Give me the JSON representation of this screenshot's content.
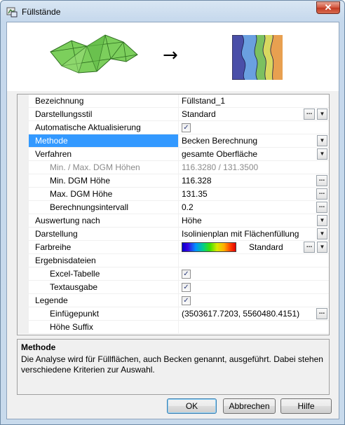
{
  "window": {
    "title": "Füllstände",
    "close_glyph": "✕"
  },
  "banner": {
    "arrow": "→"
  },
  "properties": [
    {
      "label": "Bezeichnung",
      "value": "Füllstand_1"
    },
    {
      "label": "Darstellungsstil",
      "value": "Standard"
    },
    {
      "label": "Automatische Aktualisierung",
      "checked": true
    },
    {
      "label": "Methode",
      "value": "Becken Berechnung",
      "selected": true
    },
    {
      "label": "Verfahren",
      "value": "gesamte Oberfläche"
    },
    {
      "label": "Min. / Max. DGM Höhen",
      "value": "116.3280 / 131.3500",
      "disabled": true
    },
    {
      "label": "Min. DGM Höhe",
      "value": "116.328"
    },
    {
      "label": "Max. DGM Höhe",
      "value": "131.35"
    },
    {
      "label": "Berechnungsintervall",
      "value": "0.2"
    },
    {
      "label": "Auswertung nach",
      "value": "Höhe"
    },
    {
      "label": "Darstellung",
      "value": "Isolinienplan mit Flächenfüllung"
    },
    {
      "label": "Farbreihe",
      "value": "Standard"
    },
    {
      "label": "Ergebnisdateien"
    },
    {
      "label": "Excel-Tabelle",
      "checked": true
    },
    {
      "label": "Textausgabe",
      "checked": true
    },
    {
      "label": "Legende",
      "checked": true
    },
    {
      "label": "Einfügepunkt",
      "value": "(3503617.7203, 5560480.4151)"
    },
    {
      "label": "Höhe Suffix"
    }
  ],
  "description": {
    "title": "Methode",
    "text": "Die Analyse wird für Füllflächen, auch Becken genannt, ausgeführt. Dabei stehen verschiedene Kriterien zur Auswahl."
  },
  "buttons": {
    "ok": "OK",
    "cancel": "Abbrechen",
    "help": "Hilfe"
  },
  "glyphs": {
    "dropdown": "▼",
    "ellipsis": "...",
    "check": "✓"
  },
  "colors": {
    "selection": "#3399ff",
    "terrain": "#7ccf5c",
    "iso_bg": "#4a4fa8"
  }
}
